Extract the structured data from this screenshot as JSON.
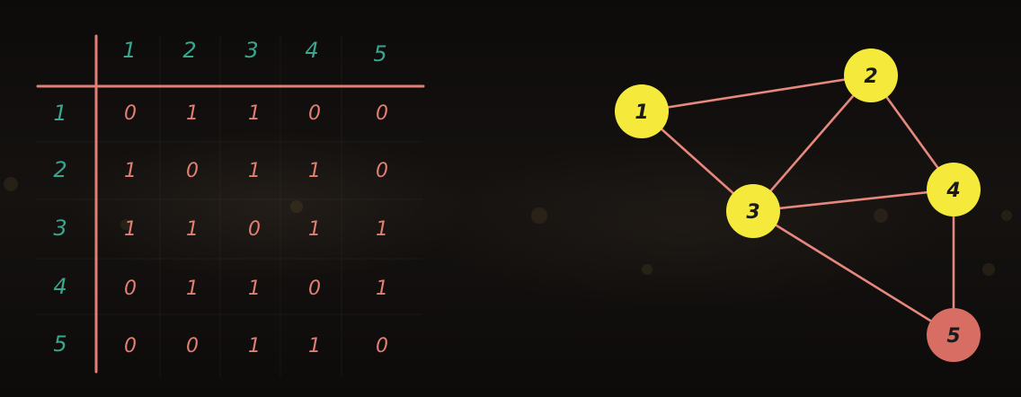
{
  "matrix": {
    "col_headers": [
      "1",
      "2",
      "3",
      "4",
      "5"
    ],
    "row_headers": [
      "1",
      "2",
      "3",
      "4",
      "5"
    ],
    "rows": [
      [
        "0",
        "1",
        "1",
        "0",
        "0"
      ],
      [
        "1",
        "0",
        "1",
        "1",
        "0"
      ],
      [
        "1",
        "1",
        "0",
        "1",
        "1"
      ],
      [
        "0",
        "1",
        "1",
        "0",
        "1"
      ],
      [
        "0",
        "0",
        "1",
        "1",
        "0"
      ]
    ],
    "header_color": "#3aa68e",
    "cell_color": "#e27f72"
  },
  "graph": {
    "nodes": [
      {
        "id": "1",
        "label": "1",
        "color": "#f5ea3c"
      },
      {
        "id": "2",
        "label": "2",
        "color": "#f5ea3c"
      },
      {
        "id": "3",
        "label": "3",
        "color": "#f5ea3c"
      },
      {
        "id": "4",
        "label": "4",
        "color": "#f5ea3c"
      },
      {
        "id": "5",
        "label": "5",
        "color": "#d86d63"
      }
    ],
    "edges": [
      [
        "1",
        "2"
      ],
      [
        "1",
        "3"
      ],
      [
        "2",
        "3"
      ],
      [
        "2",
        "4"
      ],
      [
        "3",
        "4"
      ],
      [
        "3",
        "5"
      ],
      [
        "4",
        "5"
      ]
    ],
    "edge_color": "#e6887d"
  }
}
